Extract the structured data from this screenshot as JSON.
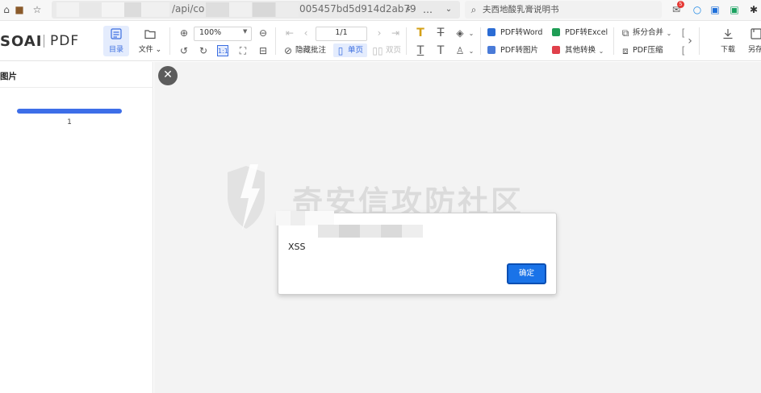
{
  "browser": {
    "url_prefix": "/api/co",
    "url_suffix": "005457bd5d914d2ab79",
    "search_text": "夫西地酸乳膏说明书",
    "notification_count": "5"
  },
  "app": {
    "logo": "SOAI",
    "logo_sub": "PDF"
  },
  "toolbar": {
    "outline_label": "目录",
    "file_label": "文件",
    "zoom_value": "100%",
    "page_value": "1/1",
    "hide_annotations_label": "隐藏批注",
    "single_page_label": "单页",
    "double_page_label": "双页",
    "pdf_to_word_label": "PDF转Word",
    "pdf_to_excel_label": "PDF转Excel",
    "pdf_to_image_label": "PDF转图片",
    "other_convert_label": "其他转换",
    "split_merge_label": "拆分合并",
    "pdf_compress_label": "PDF压缩",
    "download_label": "下载",
    "save_as_label": "另存"
  },
  "sidebar": {
    "title": "图片",
    "thumbnail_page": "1"
  },
  "main": {
    "watermark": "奇安信攻防社区"
  },
  "dialog": {
    "message": "XSS",
    "ok_label": "确定"
  },
  "colors": {
    "accent": "#3a6de0",
    "dialog_button": "#1a73e8",
    "thumb_bar": "#3d6ee8"
  }
}
